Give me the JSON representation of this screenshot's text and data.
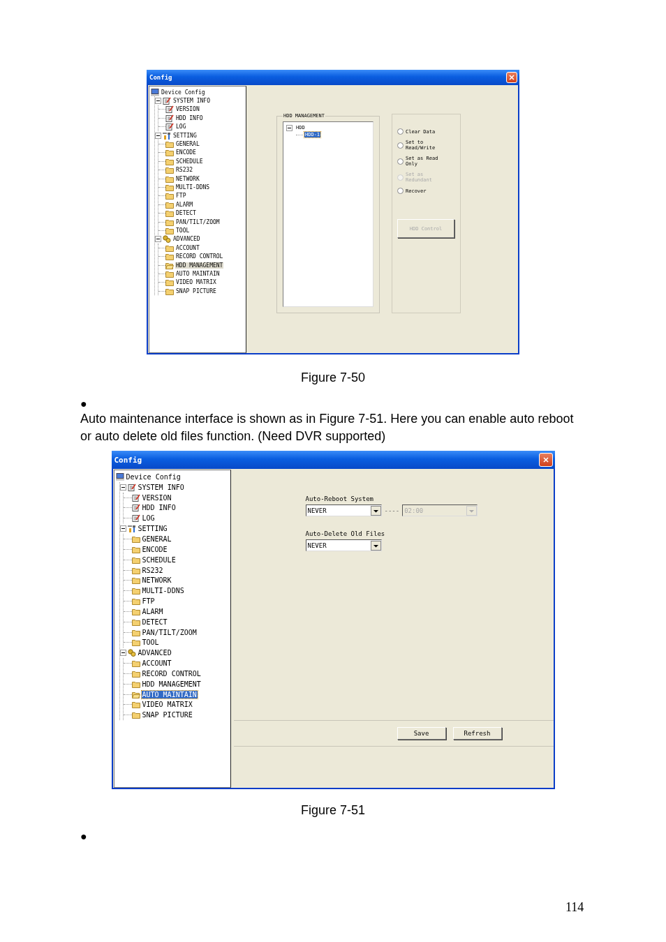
{
  "blocks": [
    {
      "kind": "window",
      "title": "Config",
      "tree": {
        "focused": false,
        "root": {
          "label": "Device Config",
          "kind": "computer",
          "selected": false,
          "children": [
            {
              "label": "SYSTEM INFO",
              "kind": "notes",
              "selected": false,
              "expanded": true,
              "children": [
                {
                  "label": "VERSION",
                  "kind": "notes",
                  "selected": false
                },
                {
                  "label": "HDD INFO",
                  "kind": "notes",
                  "selected": false
                },
                {
                  "label": "LOG",
                  "kind": "notes",
                  "selected": false
                }
              ]
            },
            {
              "label": "SETTING",
              "kind": "tools",
              "selected": false,
              "expanded": true,
              "children": [
                {
                  "label": "GENERAL",
                  "kind": "folder",
                  "selected": false
                },
                {
                  "label": "ENCODE",
                  "kind": "folder",
                  "selected": false
                },
                {
                  "label": "SCHEDULE",
                  "kind": "folder",
                  "selected": false
                },
                {
                  "label": "RS232",
                  "kind": "folder",
                  "selected": false
                },
                {
                  "label": "NETWORK",
                  "kind": "folder",
                  "selected": false
                },
                {
                  "label": "MULTI-DDNS",
                  "kind": "folder",
                  "selected": false
                },
                {
                  "label": "FTP",
                  "kind": "folder",
                  "selected": false
                },
                {
                  "label": "ALARM",
                  "kind": "folder",
                  "selected": false
                },
                {
                  "label": "DETECT",
                  "kind": "folder",
                  "selected": false
                },
                {
                  "label": "PAN/TILT/ZOOM",
                  "kind": "folder",
                  "selected": false
                },
                {
                  "label": "TOOL",
                  "kind": "folder",
                  "selected": false
                }
              ]
            },
            {
              "label": "ADVANCED",
              "kind": "gears",
              "selected": false,
              "expanded": true,
              "children": [
                {
                  "label": "ACCOUNT",
                  "kind": "folder",
                  "selected": false
                },
                {
                  "label": "RECORD CONTROL",
                  "kind": "folder",
                  "selected": false
                },
                {
                  "label": "HDD MANAGEMENT",
                  "kind": "folder",
                  "selected": true
                },
                {
                  "label": "AUTO MAINTAIN",
                  "kind": "folder",
                  "selected": false
                },
                {
                  "label": "VIDEO MATRIX",
                  "kind": "folder",
                  "selected": false
                },
                {
                  "label": "SNAP PICTURE",
                  "kind": "folder",
                  "selected": false
                }
              ]
            }
          ]
        }
      },
      "panel": {
        "kind": "hdd",
        "group_title": "HDD MANAGEMENT",
        "disk_tree": {
          "label": "HDD",
          "expanded": true,
          "selected": false,
          "children": [
            {
              "label": "HDD-1",
              "selected": true
            }
          ]
        },
        "options": [
          {
            "label": "Clear Data",
            "selected": false,
            "disabled": false
          },
          {
            "label": "Set to Read/Write",
            "selected": false,
            "disabled": false
          },
          {
            "label": "Set as Read Only",
            "selected": false,
            "disabled": false
          },
          {
            "label": "Set as Redundant",
            "selected": false,
            "disabled": true
          },
          {
            "label": "Recover",
            "selected": false,
            "disabled": false
          }
        ],
        "button": {
          "label": "HDD Control",
          "disabled": true
        }
      }
    },
    {
      "kind": "caption",
      "text": "Figure 7-50"
    },
    {
      "kind": "bullet",
      "text": "●"
    },
    {
      "kind": "paragraph",
      "text": "Auto maintenance interface is shown as in Figure 7-51. Here you can enable auto reboot or auto delete old files function. (Need DVR supported)"
    },
    {
      "kind": "window",
      "title": "Config",
      "tree": {
        "focused": true,
        "root": {
          "label": "Device Config",
          "kind": "computer",
          "selected": false,
          "children": [
            {
              "label": "SYSTEM INFO",
              "kind": "notes",
              "selected": false,
              "expanded": true,
              "children": [
                {
                  "label": "VERSION",
                  "kind": "notes",
                  "selected": false
                },
                {
                  "label": "HDD INFO",
                  "kind": "notes",
                  "selected": false
                },
                {
                  "label": "LOG",
                  "kind": "notes",
                  "selected": false
                }
              ]
            },
            {
              "label": "SETTING",
              "kind": "tools",
              "selected": false,
              "expanded": true,
              "children": [
                {
                  "label": "GENERAL",
                  "kind": "folder",
                  "selected": false
                },
                {
                  "label": "ENCODE",
                  "kind": "folder",
                  "selected": false
                },
                {
                  "label": "SCHEDULE",
                  "kind": "folder",
                  "selected": false
                },
                {
                  "label": "RS232",
                  "kind": "folder",
                  "selected": false
                },
                {
                  "label": "NETWORK",
                  "kind": "folder",
                  "selected": false
                },
                {
                  "label": "MULTI-DDNS",
                  "kind": "folder",
                  "selected": false
                },
                {
                  "label": "FTP",
                  "kind": "folder",
                  "selected": false
                },
                {
                  "label": "ALARM",
                  "kind": "folder",
                  "selected": false
                },
                {
                  "label": "DETECT",
                  "kind": "folder",
                  "selected": false
                },
                {
                  "label": "PAN/TILT/ZOOM",
                  "kind": "folder",
                  "selected": false
                },
                {
                  "label": "TOOL",
                  "kind": "folder",
                  "selected": false
                }
              ]
            },
            {
              "label": "ADVANCED",
              "kind": "gears",
              "selected": false,
              "expanded": true,
              "children": [
                {
                  "label": "ACCOUNT",
                  "kind": "folder",
                  "selected": false
                },
                {
                  "label": "RECORD CONTROL",
                  "kind": "folder",
                  "selected": false
                },
                {
                  "label": "HDD MANAGEMENT",
                  "kind": "folder",
                  "selected": false
                },
                {
                  "label": "AUTO MAINTAIN",
                  "kind": "folder",
                  "selected": true
                },
                {
                  "label": "VIDEO MATRIX",
                  "kind": "folder",
                  "selected": false
                },
                {
                  "label": "SNAP PICTURE",
                  "kind": "folder",
                  "selected": false
                }
              ]
            }
          ]
        }
      },
      "panel": {
        "kind": "maintain",
        "fields": [
          {
            "label": "Auto-Reboot System",
            "value": "NEVER",
            "separator": "----",
            "time": {
              "value": "02:00",
              "disabled": true
            }
          },
          {
            "label": "Auto-Delete Old Files",
            "value": "NEVER"
          }
        ],
        "buttons": [
          "Save",
          "Refresh"
        ]
      }
    },
    {
      "kind": "caption",
      "text": "Figure 7-51"
    },
    {
      "kind": "bullet",
      "text": "●"
    },
    {
      "kind": "page_number",
      "text": "114"
    }
  ]
}
